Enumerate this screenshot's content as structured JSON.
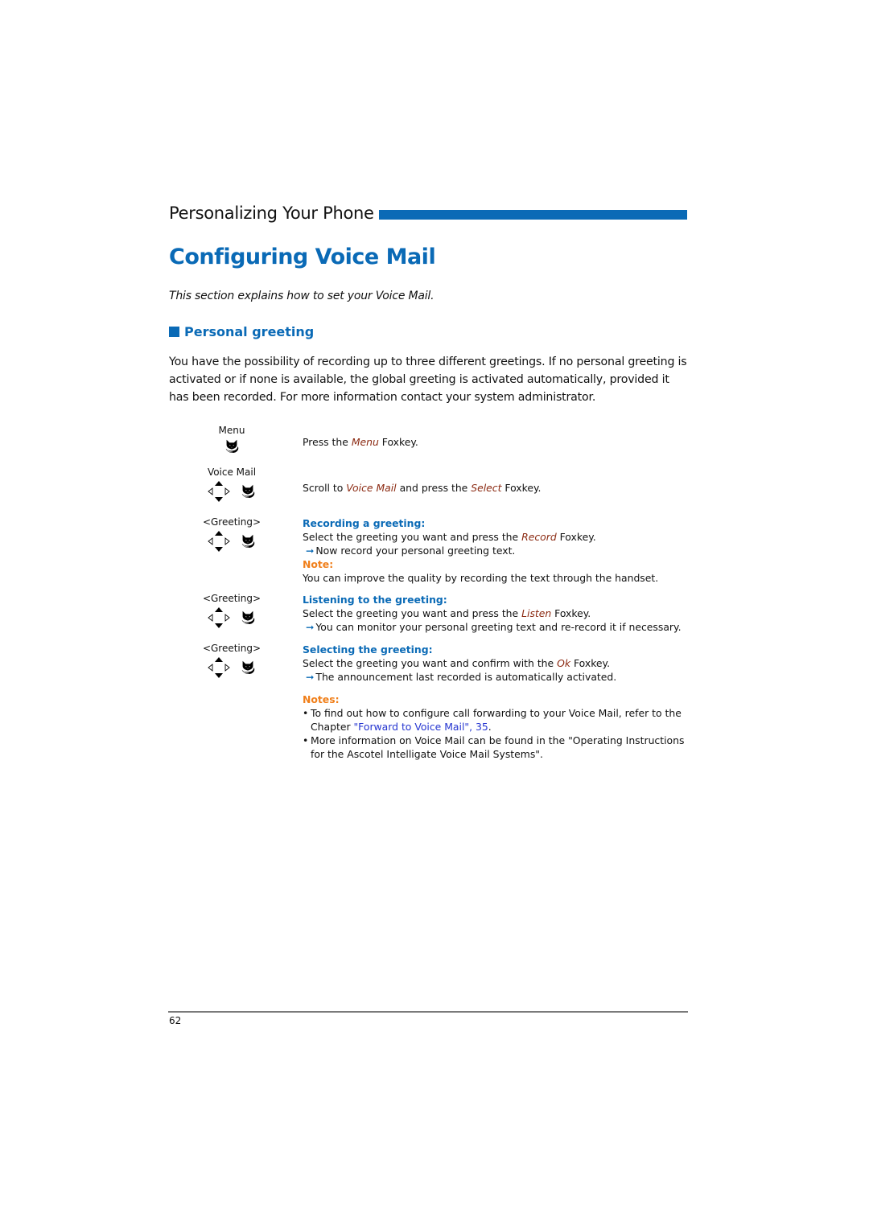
{
  "header": {
    "chapter_title": "Personalizing Your Phone",
    "accent_color": "#0a6ab6"
  },
  "page_title": "Configuring Voice Mail",
  "intro": "This section explains how to set your Voice Mail.",
  "section": {
    "heading": "Personal greeting",
    "paragraph": "You have the possibility of recording up to three different greetings. If no personal greeting is activated or if none is available, the global greeting is activated automatically, provided it has been recorded. For more information contact your system administrator."
  },
  "steps": [
    {
      "key_label": "Menu",
      "icons": [
        "foxkey-icon"
      ],
      "text_before": "Press the ",
      "keyword": "Menu",
      "text_after": " Foxkey."
    },
    {
      "key_label": "Voice Mail",
      "icons": [
        "navigation-keys-icon",
        "foxkey-icon"
      ],
      "text_before": "Scroll to ",
      "keyword": "Voice Mail",
      "text_middle": " and press the ",
      "keyword2": "Select",
      "text_after": " Foxkey."
    },
    {
      "key_label": "<Greeting>",
      "icons": [
        "navigation-keys-icon",
        "foxkey-icon"
      ],
      "heading": "Recording a greeting:",
      "text_before": "Select the greeting you want and press the ",
      "keyword": "Record",
      "text_after": " Foxkey.",
      "result": "Now record your personal greeting text.",
      "note_heading": "Note:",
      "note_text": "You can improve the quality by recording the text through the handset."
    },
    {
      "key_label": "<Greeting>",
      "icons": [
        "navigation-keys-icon",
        "foxkey-icon"
      ],
      "heading": "Listening to the greeting:",
      "text_before": "Select the greeting you want and press the ",
      "keyword": "Listen",
      "text_after": " Foxkey.",
      "result": "You can monitor your personal greeting text and re-record it if necessary."
    },
    {
      "key_label": "<Greeting>",
      "icons": [
        "navigation-keys-icon",
        "foxkey-icon"
      ],
      "heading": "Selecting the greeting:",
      "text_before": "Select the greeting you want and confirm with the ",
      "keyword": "Ok",
      "text_after": " Foxkey.",
      "result": "The announcement last recorded is automatically activated."
    }
  ],
  "notes": {
    "heading": "Notes:",
    "items": [
      {
        "text_before": "To find out how to configure call forwarding to your Voice Mail, refer to the Chapter ",
        "link": "\"Forward to Voice Mail\", 35",
        "text_after": "."
      },
      {
        "text_before": "More information on Voice Mail can be found in the \"Operating Instructions for the Ascotel Intelligate Voice Mail Systems\".",
        "link": null,
        "text_after": ""
      }
    ],
    "bullet": "•"
  },
  "arrow_glyph": "➞",
  "footer": {
    "page_number": "62"
  }
}
